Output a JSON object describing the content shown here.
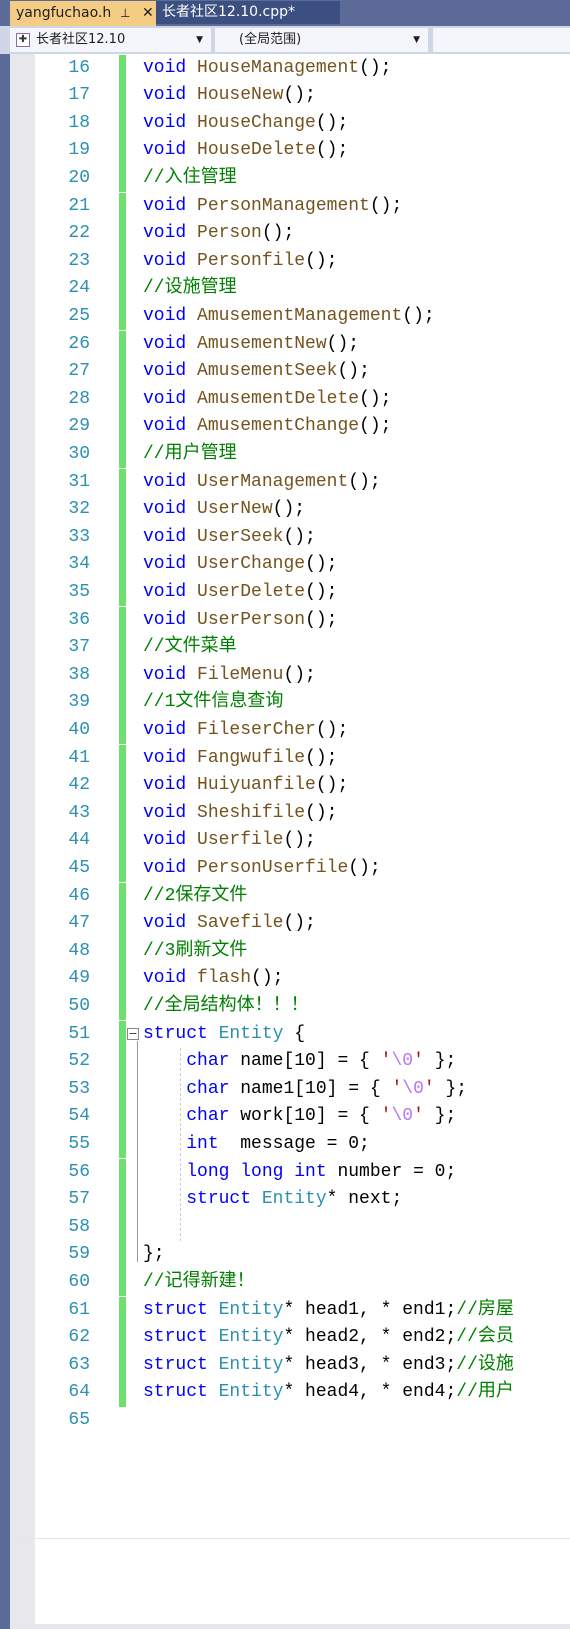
{
  "tabs": [
    {
      "label": "yangfuchao.h",
      "active": true,
      "pin": "pin-icon",
      "close": "close-icon"
    },
    {
      "label": "长者社区12.10.cpp*",
      "active": false
    }
  ],
  "toolbar": {
    "project": "长者社区12.10",
    "scope": "(全局范围)",
    "member": ""
  },
  "colors": {
    "keyword": "#0000ff",
    "function": "#74531f",
    "comment": "#008000",
    "type": "#2b91af",
    "changed": "#6ce26c",
    "tab_active": "#f5cc84"
  },
  "lines": [
    {
      "n": 16,
      "t": [
        [
          "k",
          "void"
        ],
        [
          "p",
          " "
        ],
        [
          "f",
          "HouseManagement"
        ],
        [
          "p",
          "();"
        ]
      ]
    },
    {
      "n": 17,
      "t": [
        [
          "k",
          "void"
        ],
        [
          "p",
          " "
        ],
        [
          "f",
          "HouseNew"
        ],
        [
          "p",
          "();"
        ]
      ]
    },
    {
      "n": 18,
      "t": [
        [
          "k",
          "void"
        ],
        [
          "p",
          " "
        ],
        [
          "f",
          "HouseChange"
        ],
        [
          "p",
          "();"
        ]
      ]
    },
    {
      "n": 19,
      "t": [
        [
          "k",
          "void"
        ],
        [
          "p",
          " "
        ],
        [
          "f",
          "HouseDelete"
        ],
        [
          "p",
          "();"
        ]
      ]
    },
    {
      "n": 20,
      "t": [
        [
          "c",
          "//入住管理"
        ]
      ]
    },
    {
      "n": 21,
      "t": [
        [
          "k",
          "void"
        ],
        [
          "p",
          " "
        ],
        [
          "f",
          "PersonManagement"
        ],
        [
          "p",
          "();"
        ]
      ]
    },
    {
      "n": 22,
      "t": [
        [
          "k",
          "void"
        ],
        [
          "p",
          " "
        ],
        [
          "f",
          "Person"
        ],
        [
          "p",
          "();"
        ]
      ]
    },
    {
      "n": 23,
      "t": [
        [
          "k",
          "void"
        ],
        [
          "p",
          " "
        ],
        [
          "f",
          "Personfile"
        ],
        [
          "p",
          "();"
        ]
      ]
    },
    {
      "n": 24,
      "t": [
        [
          "c",
          "//设施管理"
        ]
      ]
    },
    {
      "n": 25,
      "t": [
        [
          "k",
          "void"
        ],
        [
          "p",
          " "
        ],
        [
          "f",
          "AmusementManagement"
        ],
        [
          "p",
          "();"
        ]
      ]
    },
    {
      "n": 26,
      "t": [
        [
          "k",
          "void"
        ],
        [
          "p",
          " "
        ],
        [
          "f",
          "AmusementNew"
        ],
        [
          "p",
          "();"
        ]
      ]
    },
    {
      "n": 27,
      "t": [
        [
          "k",
          "void"
        ],
        [
          "p",
          " "
        ],
        [
          "f",
          "AmusementSeek"
        ],
        [
          "p",
          "();"
        ]
      ]
    },
    {
      "n": 28,
      "t": [
        [
          "k",
          "void"
        ],
        [
          "p",
          " "
        ],
        [
          "f",
          "AmusementDelete"
        ],
        [
          "p",
          "();"
        ]
      ]
    },
    {
      "n": 29,
      "t": [
        [
          "k",
          "void"
        ],
        [
          "p",
          " "
        ],
        [
          "f",
          "AmusementChange"
        ],
        [
          "p",
          "();"
        ]
      ]
    },
    {
      "n": 30,
      "t": [
        [
          "c",
          "//用户管理"
        ]
      ]
    },
    {
      "n": 31,
      "t": [
        [
          "k",
          "void"
        ],
        [
          "p",
          " "
        ],
        [
          "f",
          "UserManagement"
        ],
        [
          "p",
          "();"
        ]
      ]
    },
    {
      "n": 32,
      "t": [
        [
          "k",
          "void"
        ],
        [
          "p",
          " "
        ],
        [
          "f",
          "UserNew"
        ],
        [
          "p",
          "();"
        ]
      ]
    },
    {
      "n": 33,
      "t": [
        [
          "k",
          "void"
        ],
        [
          "p",
          " "
        ],
        [
          "f",
          "UserSeek"
        ],
        [
          "p",
          "();"
        ]
      ]
    },
    {
      "n": 34,
      "t": [
        [
          "k",
          "void"
        ],
        [
          "p",
          " "
        ],
        [
          "f",
          "UserChange"
        ],
        [
          "p",
          "();"
        ]
      ]
    },
    {
      "n": 35,
      "t": [
        [
          "k",
          "void"
        ],
        [
          "p",
          " "
        ],
        [
          "f",
          "UserDelete"
        ],
        [
          "p",
          "();"
        ]
      ]
    },
    {
      "n": 36,
      "t": [
        [
          "k",
          "void"
        ],
        [
          "p",
          " "
        ],
        [
          "f",
          "UserPerson"
        ],
        [
          "p",
          "();"
        ]
      ]
    },
    {
      "n": 37,
      "t": [
        [
          "c",
          "//文件菜单"
        ]
      ]
    },
    {
      "n": 38,
      "t": [
        [
          "k",
          "void"
        ],
        [
          "p",
          " "
        ],
        [
          "f",
          "FileMenu"
        ],
        [
          "p",
          "();"
        ]
      ]
    },
    {
      "n": 39,
      "t": [
        [
          "c",
          "//1文件信息查询"
        ]
      ]
    },
    {
      "n": 40,
      "t": [
        [
          "k",
          "void"
        ],
        [
          "p",
          " "
        ],
        [
          "f",
          "FileserCher"
        ],
        [
          "p",
          "();"
        ]
      ]
    },
    {
      "n": 41,
      "t": [
        [
          "k",
          "void"
        ],
        [
          "p",
          " "
        ],
        [
          "f",
          "Fangwufile"
        ],
        [
          "p",
          "();"
        ]
      ]
    },
    {
      "n": 42,
      "t": [
        [
          "k",
          "void"
        ],
        [
          "p",
          " "
        ],
        [
          "f",
          "Huiyuanfile"
        ],
        [
          "p",
          "();"
        ]
      ]
    },
    {
      "n": 43,
      "t": [
        [
          "k",
          "void"
        ],
        [
          "p",
          " "
        ],
        [
          "f",
          "Sheshifile"
        ],
        [
          "p",
          "();"
        ]
      ]
    },
    {
      "n": 44,
      "t": [
        [
          "k",
          "void"
        ],
        [
          "p",
          " "
        ],
        [
          "f",
          "Userfile"
        ],
        [
          "p",
          "();"
        ]
      ]
    },
    {
      "n": 45,
      "t": [
        [
          "k",
          "void"
        ],
        [
          "p",
          " "
        ],
        [
          "f",
          "PersonUserfile"
        ],
        [
          "p",
          "();"
        ]
      ]
    },
    {
      "n": 46,
      "t": [
        [
          "c",
          "//2保存文件"
        ]
      ]
    },
    {
      "n": 47,
      "t": [
        [
          "k",
          "void"
        ],
        [
          "p",
          " "
        ],
        [
          "f",
          "Savefile"
        ],
        [
          "p",
          "();"
        ]
      ]
    },
    {
      "n": 48,
      "t": [
        [
          "c",
          "//3刷新文件"
        ]
      ]
    },
    {
      "n": 49,
      "t": [
        [
          "k",
          "void"
        ],
        [
          "p",
          " "
        ],
        [
          "f",
          "flash"
        ],
        [
          "p",
          "();"
        ]
      ]
    },
    {
      "n": 50,
      "t": [
        [
          "c",
          "//全局结构体！！！"
        ]
      ]
    },
    {
      "n": 51,
      "t": [
        [
          "k",
          "struct"
        ],
        [
          "p",
          " "
        ],
        [
          "t",
          "Entity"
        ],
        [
          "p",
          " {"
        ]
      ],
      "fold": "collapse-icon"
    },
    {
      "n": 52,
      "t": [
        [
          "p",
          "    "
        ],
        [
          "k",
          "char"
        ],
        [
          "p",
          " name[10] = { "
        ],
        [
          "s",
          "'"
        ],
        [
          "e",
          "\\0"
        ],
        [
          "s",
          "'"
        ],
        [
          "p",
          " };"
        ]
      ]
    },
    {
      "n": 53,
      "t": [
        [
          "p",
          "    "
        ],
        [
          "k",
          "char"
        ],
        [
          "p",
          " name1[10] = { "
        ],
        [
          "s",
          "'"
        ],
        [
          "e",
          "\\0"
        ],
        [
          "s",
          "'"
        ],
        [
          "p",
          " };"
        ]
      ]
    },
    {
      "n": 54,
      "t": [
        [
          "p",
          "    "
        ],
        [
          "k",
          "char"
        ],
        [
          "p",
          " work[10] = { "
        ],
        [
          "s",
          "'"
        ],
        [
          "e",
          "\\0"
        ],
        [
          "s",
          "'"
        ],
        [
          "p",
          " };"
        ]
      ]
    },
    {
      "n": 55,
      "t": [
        [
          "p",
          "    "
        ],
        [
          "k",
          "int"
        ],
        [
          "p",
          "  message = 0;"
        ]
      ]
    },
    {
      "n": 56,
      "t": [
        [
          "p",
          "    "
        ],
        [
          "k",
          "long long int"
        ],
        [
          "p",
          " number = 0;"
        ]
      ]
    },
    {
      "n": 57,
      "t": [
        [
          "p",
          "    "
        ],
        [
          "k",
          "struct"
        ],
        [
          "p",
          " "
        ],
        [
          "t",
          "Entity"
        ],
        [
          "p",
          "* next;"
        ]
      ]
    },
    {
      "n": 58,
      "t": []
    },
    {
      "n": 59,
      "t": [
        [
          "p",
          "};"
        ]
      ]
    },
    {
      "n": 60,
      "t": [
        [
          "c",
          "//记得新建！"
        ]
      ]
    },
    {
      "n": 61,
      "t": [
        [
          "k",
          "struct"
        ],
        [
          "p",
          " "
        ],
        [
          "t",
          "Entity"
        ],
        [
          "p",
          "* head1, * end1;"
        ],
        [
          "c",
          "//房屋"
        ]
      ]
    },
    {
      "n": 62,
      "t": [
        [
          "k",
          "struct"
        ],
        [
          "p",
          " "
        ],
        [
          "t",
          "Entity"
        ],
        [
          "p",
          "* head2, * end2;"
        ],
        [
          "c",
          "//会员"
        ]
      ]
    },
    {
      "n": 63,
      "t": [
        [
          "k",
          "struct"
        ],
        [
          "p",
          " "
        ],
        [
          "t",
          "Entity"
        ],
        [
          "p",
          "* head3, * end3;"
        ],
        [
          "c",
          "//设施"
        ]
      ]
    },
    {
      "n": 64,
      "t": [
        [
          "k",
          "struct"
        ],
        [
          "p",
          " "
        ],
        [
          "t",
          "Entity"
        ],
        [
          "p",
          "* head4, * end4;"
        ],
        [
          "c",
          "//用户"
        ]
      ]
    },
    {
      "n": 65,
      "t": [],
      "unchanged": true
    }
  ]
}
